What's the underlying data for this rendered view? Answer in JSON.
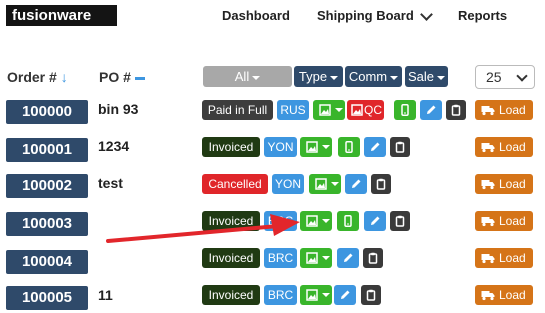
{
  "app": {
    "logo": "fusionware"
  },
  "nav": {
    "dashboard": "Dashboard",
    "shipping_board": "Shipping Board",
    "reports": "Reports"
  },
  "columns": {
    "order": "Order #",
    "po": "PO #"
  },
  "filters": {
    "all": "All",
    "type": "Type",
    "comm": "Comm",
    "sale": "Sale"
  },
  "page_size": {
    "selected": "25"
  },
  "load_label": "Load",
  "colors": {
    "order_badge": "#2f4a6a",
    "green": "#39b52b",
    "blue": "#3d96e0",
    "orange": "#d57418",
    "red": "#e0262a",
    "arrow": "#e2262b"
  },
  "rows": [
    {
      "order": "100000",
      "po": "bin 93",
      "status": "Paid in Full",
      "code": "RUS",
      "qc": "QC"
    },
    {
      "order": "100001",
      "po": "1234",
      "status": "Invoiced",
      "code": "YON"
    },
    {
      "order": "100002",
      "po": "test",
      "status": "Cancelled",
      "code": "YON"
    },
    {
      "order": "100003",
      "po": "",
      "status": "Invoiced",
      "code": "BRC"
    },
    {
      "order": "100004",
      "po": "",
      "status": "Invoiced",
      "code": "BRC"
    },
    {
      "order": "100005",
      "po": "11",
      "status": "Invoiced",
      "code": "BRC"
    }
  ]
}
